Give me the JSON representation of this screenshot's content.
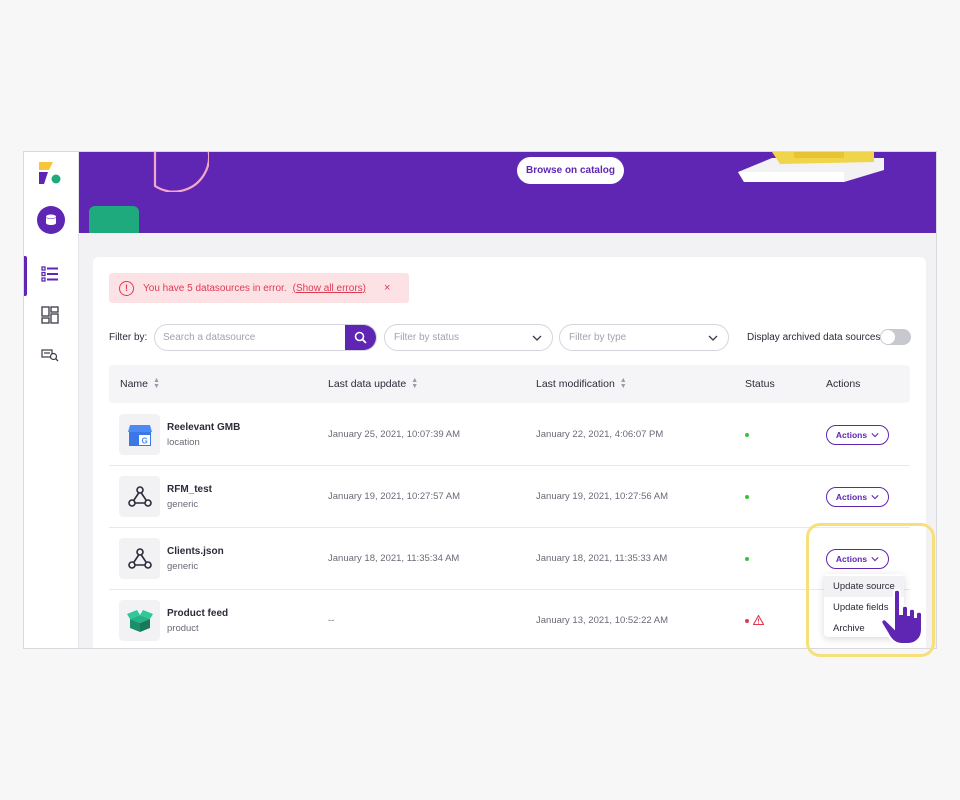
{
  "sidebar": {
    "logo_icon": "brand-logo-icon",
    "db_icon": "database-icon",
    "nav": [
      {
        "icon": "list-icon",
        "active": true
      },
      {
        "icon": "dashboard-icon",
        "active": false
      },
      {
        "icon": "catalog-search-icon",
        "active": false
      }
    ]
  },
  "banner": {
    "browse_label": "Browse on catalog",
    "color": "#5f26b4",
    "tab_color": "#1faa7e"
  },
  "error": {
    "message": "You have 5 datasources in error.",
    "link": "(Show all errors)",
    "close": "×"
  },
  "filters": {
    "label": "Filter by:",
    "search_placeholder": "Search a datasource",
    "status_placeholder": "Filter by status",
    "type_placeholder": "Filter by type",
    "archived_label": "Display archived data sources",
    "archived_on": false
  },
  "table": {
    "headers": {
      "name": "Name",
      "last_update": "Last data update",
      "last_mod": "Last modification",
      "status": "Status",
      "actions": "Actions"
    },
    "rows": [
      {
        "name": "Reelevant GMB",
        "type": "location",
        "last_update": "January 25, 2021, 10:07:39 AM",
        "last_mod": "January 22, 2021, 4:06:07 PM",
        "status": "ok",
        "icon": "google-my-business-icon",
        "action": "Actions"
      },
      {
        "name": "RFM_test",
        "type": "generic",
        "last_update": "January 19, 2021, 10:27:57 AM",
        "last_mod": "January 19, 2021, 10:27:56 AM",
        "status": "ok",
        "icon": "graph-nodes-icon",
        "action": "Actions"
      },
      {
        "name": "Clients.json",
        "type": "generic",
        "last_update": "January 18, 2021, 11:35:34 AM",
        "last_mod": "January 18, 2021, 11:35:33 AM",
        "status": "ok",
        "icon": "graph-nodes-icon",
        "action": "Actions"
      },
      {
        "name": "Product feed",
        "type": "product",
        "last_update": "--",
        "last_mod": "January 13, 2021, 10:52:22 AM",
        "status": "error",
        "icon": "product-box-icon",
        "action": "Actions"
      }
    ]
  },
  "dropdown": {
    "items": [
      "Update source",
      "Update fields",
      "Archive"
    ]
  },
  "colors": {
    "accent": "#5f26b4",
    "ok": "#3cc13b",
    "error": "#e03a52",
    "highlight": "#f7e07a"
  }
}
